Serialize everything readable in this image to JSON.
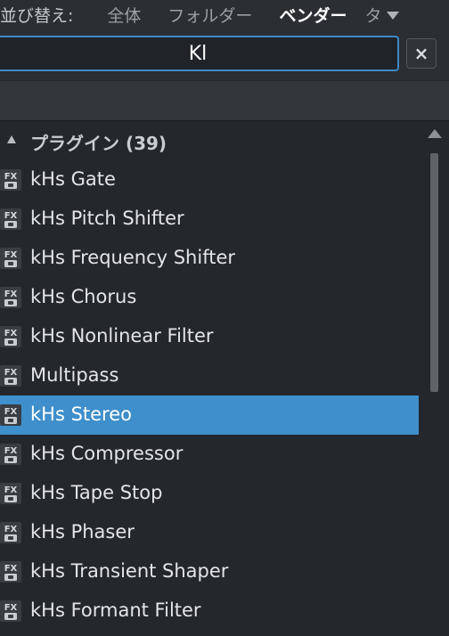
{
  "sortbar": {
    "label": "並び替え:",
    "options": [
      "全体",
      "フォルダー",
      "ベンダー",
      "タ"
    ],
    "active": "ベンダー"
  },
  "search": {
    "value": "Kl",
    "clear_label": "×"
  },
  "list": {
    "header": "プラグイン (39)",
    "items": [
      {
        "label": "kHs Gate",
        "icon": "fx-plugin-icon"
      },
      {
        "label": "kHs Pitch Shifter",
        "icon": "fx-plugin-icon"
      },
      {
        "label": "kHs Frequency Shifter",
        "icon": "fx-plugin-icon"
      },
      {
        "label": "kHs Chorus",
        "icon": "fx-plugin-icon"
      },
      {
        "label": "kHs Nonlinear Filter",
        "icon": "fx-plugin-icon"
      },
      {
        "label": "Multipass",
        "icon": "fx-plugin-icon"
      },
      {
        "label": "kHs Stereo",
        "icon": "fx-plugin-icon",
        "selected": true
      },
      {
        "label": "kHs Compressor",
        "icon": "fx-plugin-icon"
      },
      {
        "label": "kHs Tape Stop",
        "icon": "fx-plugin-icon"
      },
      {
        "label": "kHs Phaser",
        "icon": "fx-plugin-icon"
      },
      {
        "label": "kHs Transient Shaper",
        "icon": "fx-plugin-icon"
      },
      {
        "label": "kHs Formant Filter",
        "icon": "fx-plugin-icon"
      }
    ]
  },
  "colors": {
    "background": "#24272b",
    "selection": "#3e8fcb",
    "focus_border": "#3d89c7"
  }
}
